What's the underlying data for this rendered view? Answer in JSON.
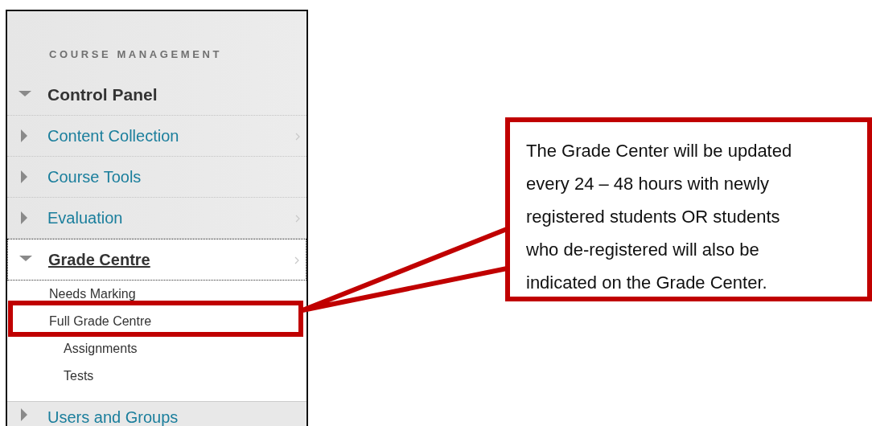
{
  "sidebar": {
    "heading": "COURSE MANAGEMENT",
    "items": [
      {
        "label": "Control Panel",
        "kind": "header",
        "expanded": true,
        "has_submenu": false
      },
      {
        "label": "Content Collection",
        "kind": "link",
        "expanded": false,
        "has_submenu": true
      },
      {
        "label": "Course Tools",
        "kind": "link",
        "expanded": false,
        "has_submenu": false
      },
      {
        "label": "Evaluation",
        "kind": "link",
        "expanded": false,
        "has_submenu": true
      },
      {
        "label": "Grade Centre",
        "kind": "current",
        "expanded": true,
        "has_submenu": true,
        "children": [
          {
            "label": "Needs Marking",
            "highlighted": false
          },
          {
            "label": "Full Grade Centre",
            "highlighted": true,
            "children": [
              {
                "label": "Assignments",
                "highlighted": false
              },
              {
                "label": "Tests",
                "highlighted": false
              }
            ]
          }
        ]
      },
      {
        "label": "Users and Groups",
        "kind": "link",
        "expanded": false,
        "has_submenu": false
      }
    ]
  },
  "callout": {
    "text": "The Grade Center will be updated every 24 – 48 hours with newly registered students OR students who de-registered will also be indicated on the Grade Center."
  }
}
